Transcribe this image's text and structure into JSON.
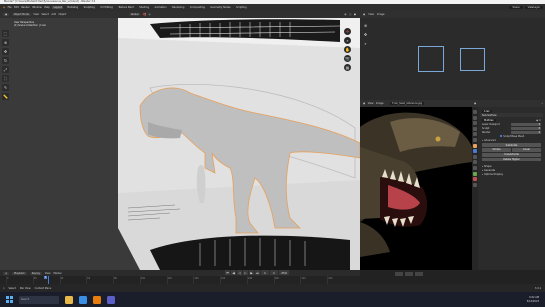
{
  "window": {
    "title": "Blender* [C:\\Users\\Models\\T-Rex\\Tyrannosaurus_Rex_v2.blend] - Blender 3.4"
  },
  "menubar": {
    "items": [
      "File",
      "Edit",
      "Render",
      "Window",
      "Help"
    ],
    "workspaces": [
      "Layout",
      "Modeling",
      "Sculpting",
      "UV Editing",
      "Texture Paint",
      "Shading",
      "Animation",
      "Rendering",
      "Compositing",
      "Geometry Nodes",
      "Scripting"
    ],
    "active_workspace": "Layout",
    "scene": "Scene",
    "view_layer": "ViewLayer"
  },
  "viewport": {
    "mode": "Object Mode",
    "menus": [
      "View",
      "Select",
      "Add",
      "Object"
    ],
    "orientation": "Global",
    "view_name": "User Perspective",
    "collection_info": "(1) Scene Collection | t-rex"
  },
  "image_editor": {
    "menus": [
      "View",
      "Image"
    ],
    "image_name": "Untitled"
  },
  "reference_editor": {
    "menus": [
      "View",
      "Image"
    ],
    "image_name": "T-rex_head_reference.jpg",
    "slot": "Render Result"
  },
  "properties": {
    "object_name": "t-rex",
    "panel_title": "Sub-Surface",
    "modifier_name": "Multires",
    "level_viewport_label": "Level Viewport",
    "level_viewport": "3",
    "sculpt_label": "Sculpt",
    "sculpt": "3",
    "render_label": "Render",
    "render": "3",
    "sculpt_base_mesh": "Sculpt Base Mesh",
    "optimal_display": "Optimal Display",
    "advanced": "Advanced",
    "subdivide_label": "Subdivide",
    "simple_label": "Simple",
    "linear_label": "Linear",
    "unsubdivide_label": "Unsubdivide",
    "delete_higher_label": "Delete Higher",
    "shape_label": "Shape",
    "generate_label": "Generate",
    "save_external_label": "Save External"
  },
  "timeline": {
    "menus": [
      "Playback",
      "Keying",
      "View",
      "Marker"
    ],
    "ticks": [
      "0",
      "20",
      "40",
      "60",
      "80",
      "100",
      "120",
      "140",
      "160",
      "180",
      "200",
      "220",
      "240"
    ],
    "current_frame": "1",
    "start": "1",
    "end": "250"
  },
  "statusbar": {
    "items": [
      "Select",
      "Pan View",
      "Context Menu"
    ],
    "version": "3.4.1"
  },
  "taskbar": {
    "search_placeholder": "Search",
    "time": "9:22 AM",
    "date": "5/10/2023"
  },
  "colors": {
    "accent": "#4a7bd1",
    "viewport_bg": "#3a3a3a",
    "selection_outline": "#e8a05a"
  }
}
